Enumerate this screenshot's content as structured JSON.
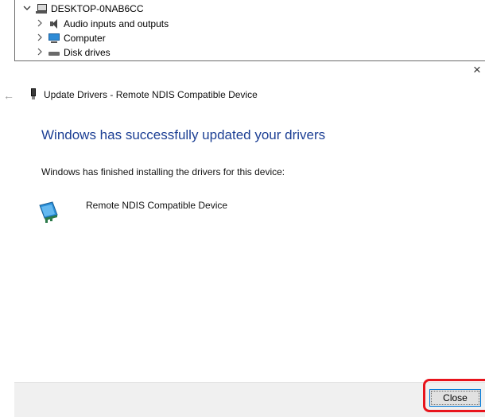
{
  "device_tree": {
    "root": {
      "label": "DESKTOP-0NAB6CC",
      "expander": "chevron-down-icon",
      "icon": "computer-network-icon"
    },
    "items": [
      {
        "label": "Audio inputs and outputs",
        "expander": "chevron-right-icon",
        "icon": "speaker-icon"
      },
      {
        "label": "Computer",
        "expander": "chevron-right-icon",
        "icon": "monitor-icon"
      },
      {
        "label": "Disk drives",
        "expander": "chevron-right-icon",
        "icon": "disk-drive-icon"
      }
    ]
  },
  "wizard": {
    "title": "Update Drivers - Remote NDIS Compatible Device",
    "heading": "Windows has successfully updated your drivers",
    "description": "Windows has finished installing the drivers for this device:",
    "device_name": "Remote NDIS Compatible Device",
    "close_label": "Close"
  },
  "icons": {
    "close": "×",
    "back": "←",
    "chevron_down": "⌄",
    "chevron_right": "›"
  },
  "colors": {
    "heading": "#1c3f94",
    "footer_bg": "#f0f0f0",
    "highlight": "#e8141c",
    "button_border": "#0078d7"
  }
}
